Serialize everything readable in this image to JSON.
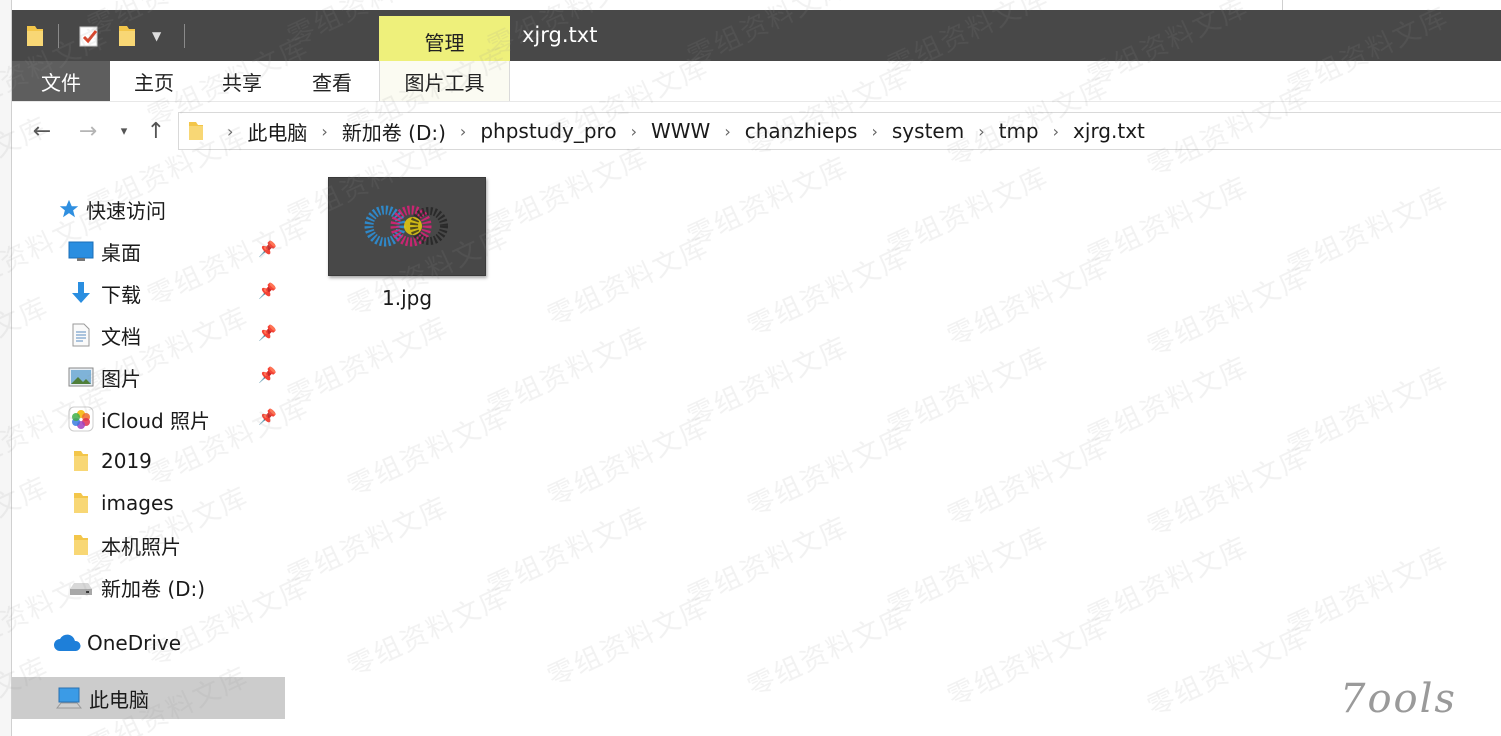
{
  "titlebar": {
    "title": "xjrg.txt",
    "manage_tab": "管理"
  },
  "ribbon": {
    "tabs": [
      "文件",
      "主页",
      "共享",
      "查看",
      "图片工具"
    ]
  },
  "address": {
    "crumbs": [
      "此电脑",
      "新加卷 (D:)",
      "phpstudy_pro",
      "WWW",
      "chanzhieps",
      "system",
      "tmp",
      "xjrg.txt"
    ]
  },
  "sidebar": {
    "quick_access": "快速访问",
    "items": [
      {
        "label": "桌面",
        "icon": "desktop-icon",
        "pinned": true
      },
      {
        "label": "下载",
        "icon": "download-icon",
        "pinned": true
      },
      {
        "label": "文档",
        "icon": "documents-icon",
        "pinned": true
      },
      {
        "label": "图片",
        "icon": "pictures-icon",
        "pinned": true
      },
      {
        "label": "iCloud 照片",
        "icon": "icloud-photos-icon",
        "pinned": true
      },
      {
        "label": "2019",
        "icon": "folder-icon",
        "pinned": false
      },
      {
        "label": "images",
        "icon": "folder-icon",
        "pinned": false
      },
      {
        "label": "本机照片",
        "icon": "folder-icon",
        "pinned": false
      },
      {
        "label": "新加卷 (D:)",
        "icon": "drive-icon",
        "pinned": false
      }
    ],
    "onedrive": "OneDrive",
    "this_pc": "此电脑"
  },
  "files": [
    {
      "name": "1.jpg",
      "icon": "image-thumbnail"
    }
  ],
  "watermark": "零组资料文库",
  "logo": "7ools",
  "colors": {
    "titlebar": "#484848",
    "manage_tab": "#eef07b",
    "file_tab": "#5e5e5e",
    "selected": "#cccccc"
  }
}
